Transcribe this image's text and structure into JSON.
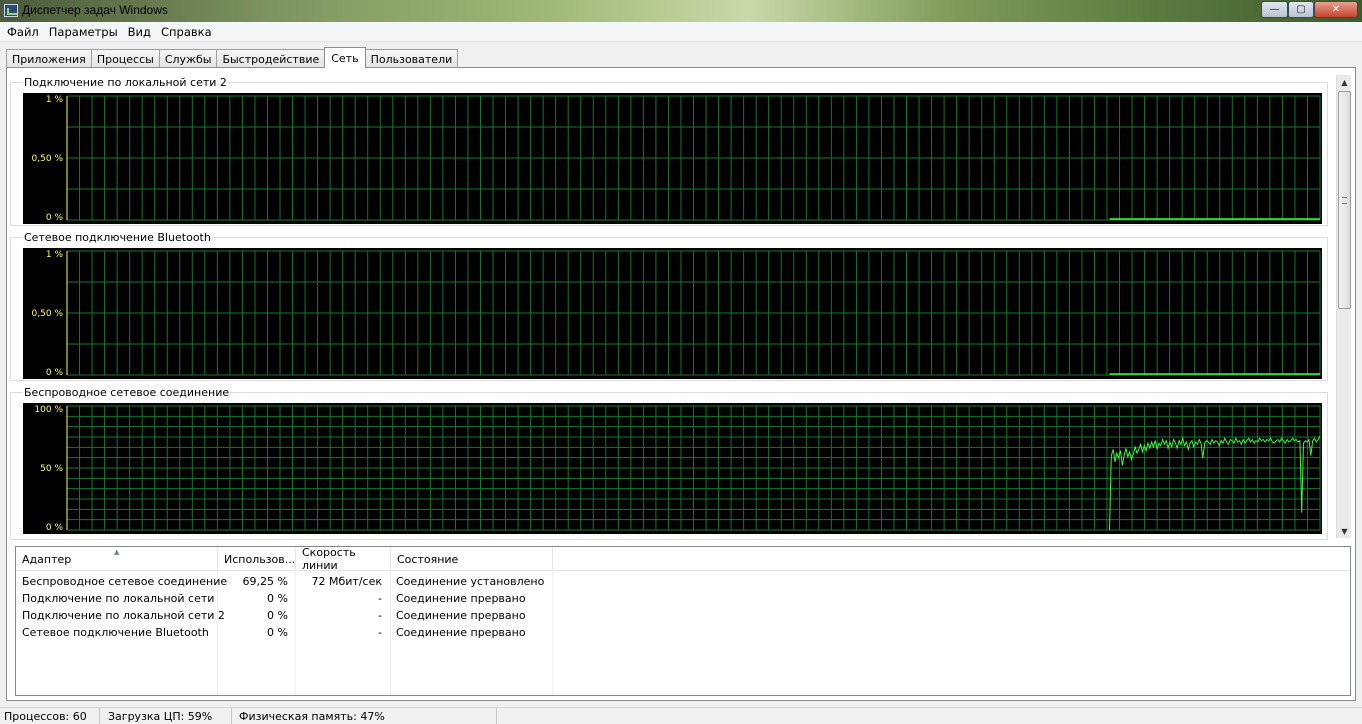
{
  "window": {
    "title": "Диспетчер задач Windows",
    "controls": {
      "minimize": "—",
      "maximize": "▢",
      "close": "✕"
    }
  },
  "menu": [
    "Файл",
    "Параметры",
    "Вид",
    "Справка"
  ],
  "tabs": [
    {
      "label": "Приложения",
      "active": false
    },
    {
      "label": "Процессы",
      "active": false
    },
    {
      "label": "Службы",
      "active": false
    },
    {
      "label": "Быстродействие",
      "active": false
    },
    {
      "label": "Сеть",
      "active": true
    },
    {
      "label": "Пользователи",
      "active": false
    }
  ],
  "graphs": [
    {
      "name": "Подключение по локальной сети 2",
      "y_labels": [
        "1 %",
        "0,50 %",
        "0 %"
      ],
      "series_percent": "flat-zero"
    },
    {
      "name": "Сетевое подключение Bluetooth",
      "y_labels": [
        "1 %",
        "0,50 %",
        "0 %"
      ],
      "series_percent": "flat-zero"
    },
    {
      "name": "Беспроводное сетевое соединение",
      "y_labels": [
        "100 %",
        "50 %",
        "0 %"
      ],
      "series_percent": [
        0,
        60,
        65,
        55,
        62,
        58,
        64,
        52,
        60,
        66,
        59,
        63,
        57,
        61,
        67,
        62,
        65,
        69,
        63,
        68,
        64,
        70,
        66,
        71,
        67,
        72,
        65,
        70,
        68,
        73,
        69,
        72,
        66,
        71,
        67,
        73,
        70,
        66,
        72,
        69,
        74,
        68,
        71,
        65,
        70,
        72,
        67,
        71,
        69,
        73,
        70,
        58,
        70,
        72,
        71,
        69,
        73,
        70,
        72,
        71,
        68,
        72,
        70,
        74,
        71,
        69,
        73,
        72,
        70,
        74,
        71,
        72,
        69,
        73,
        70,
        72,
        74,
        71,
        73,
        70,
        72,
        71,
        74,
        72,
        73,
        71,
        73,
        72,
        74,
        71,
        70,
        72,
        73,
        71,
        74,
        72,
        70,
        73,
        71,
        72,
        74,
        72,
        73,
        71,
        72,
        14,
        70,
        72,
        71,
        73,
        60,
        72,
        74,
        71,
        73,
        76
      ]
    }
  ],
  "chart_colors": {
    "grid": "#0f7a2f",
    "line": "#32ff32",
    "label": "#ffff55"
  },
  "table": {
    "columns": [
      "Адаптер",
      "Использов...",
      "Скорость линии",
      "Состояние"
    ],
    "rows": [
      {
        "adapter": "Беспроводное сетевое соединение",
        "usage": "69,25 %",
        "speed": "72 Мбит/сек",
        "state": "Соединение установлено"
      },
      {
        "adapter": "Подключение по локальной сети",
        "usage": "0 %",
        "speed": "-",
        "state": "Соединение прервано"
      },
      {
        "adapter": "Подключение по локальной сети 2",
        "usage": "0 %",
        "speed": "-",
        "state": "Соединение прервано"
      },
      {
        "adapter": "Сетевое подключение Bluetooth",
        "usage": "0 %",
        "speed": "-",
        "state": "Соединение прервано"
      }
    ]
  },
  "status": {
    "processes": "Процессов: 60",
    "cpu": "Загрузка ЦП: 59%",
    "memory": "Физическая память: 47%"
  }
}
